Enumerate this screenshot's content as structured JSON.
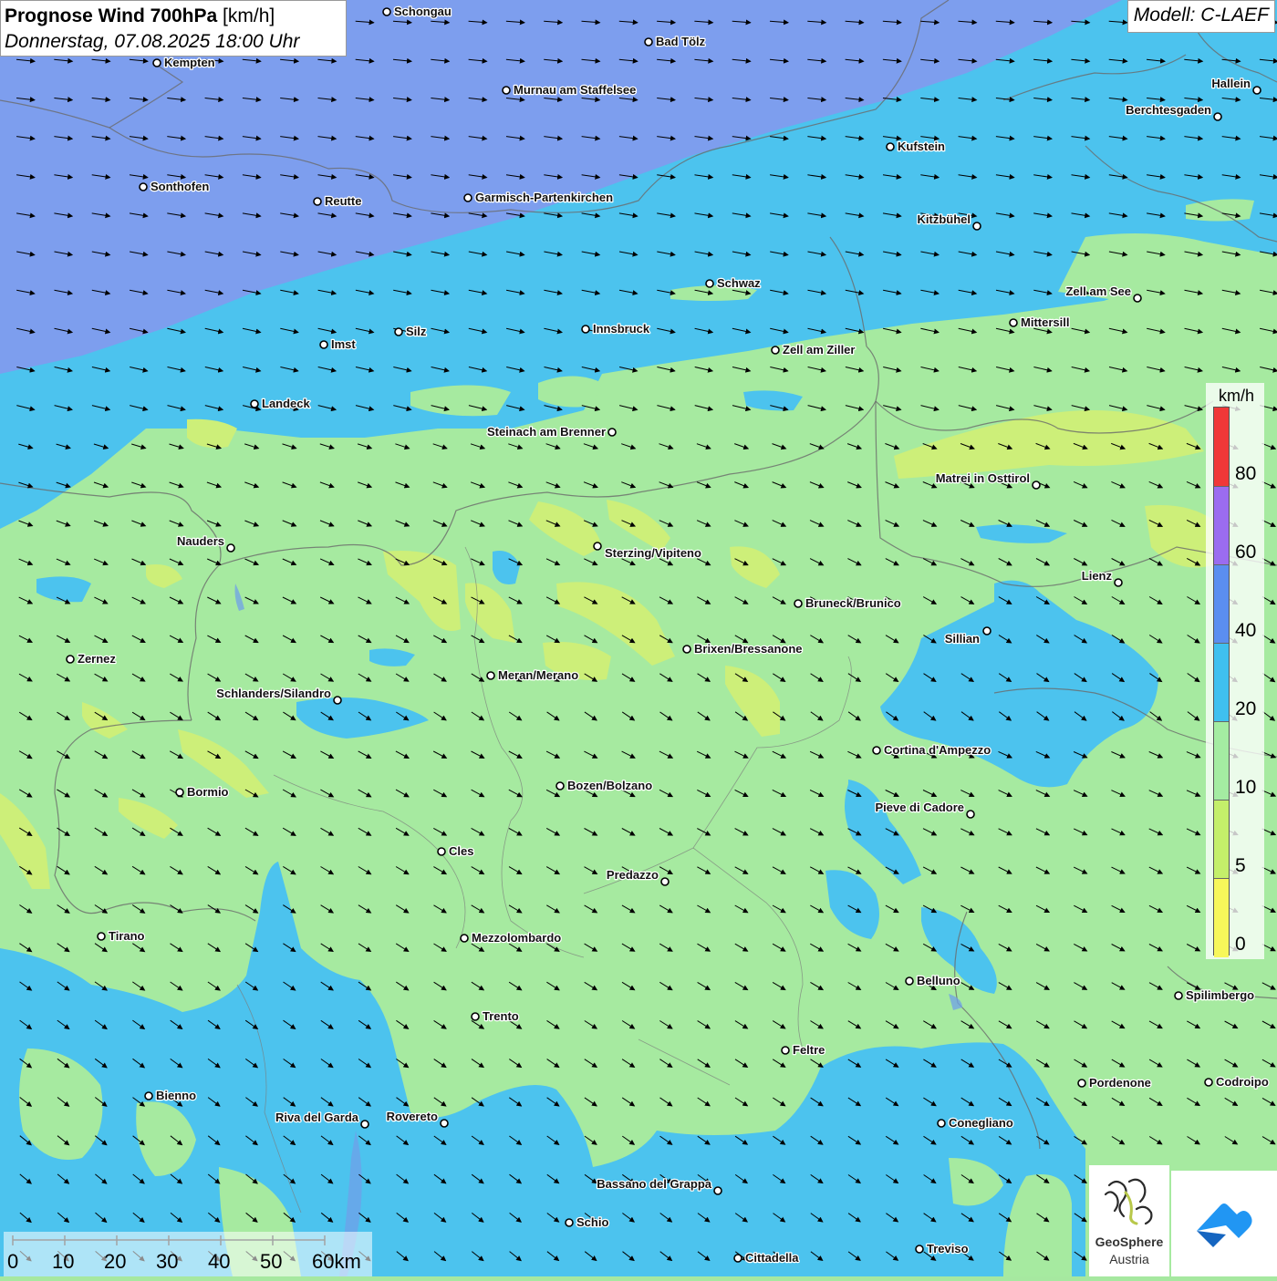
{
  "header": {
    "title_bold": "Prognose Wind 700hPa",
    "title_unit": "[km/h]",
    "subtitle": "Donnerstag, 07.08.2025 18:00 Uhr",
    "model": "Modell: C-LAEF"
  },
  "legend": {
    "unit": "km/h",
    "classes": [
      {
        "label": "0",
        "color": "#f7f75a"
      },
      {
        "label": "5",
        "color": "#c4ef6a"
      },
      {
        "label": "10",
        "color": "#a4eca2"
      },
      {
        "label": "20",
        "color": "#3fc0ef"
      },
      {
        "label": "40",
        "color": "#5b8ef0"
      },
      {
        "label": "60",
        "color": "#9b6cf0"
      },
      {
        "label": "80",
        "color": "#f03838"
      }
    ]
  },
  "scalebar": {
    "ticks": [
      "0",
      "10",
      "20",
      "30",
      "40",
      "50",
      "60km"
    ]
  },
  "logos": {
    "geosphere_line1": "GeoSphere",
    "geosphere_line2": "Austria"
  },
  "cities": [
    {
      "name": "Schongau"
    },
    {
      "name": "Bad Tölz"
    },
    {
      "name": "Kempten"
    },
    {
      "name": "Murnau am Staffelsee"
    },
    {
      "name": "Hallein"
    },
    {
      "name": "Berchtesgaden"
    },
    {
      "name": "Kufstein"
    },
    {
      "name": "Sonthofen"
    },
    {
      "name": "Reutte"
    },
    {
      "name": "Garmisch-Partenkirchen"
    },
    {
      "name": "Kitzbühel"
    },
    {
      "name": "Schwaz"
    },
    {
      "name": "Zell am See"
    },
    {
      "name": "Mittersill"
    },
    {
      "name": "Innsbruck"
    },
    {
      "name": "Silz"
    },
    {
      "name": "Imst"
    },
    {
      "name": "Zell am Ziller"
    },
    {
      "name": "Landeck"
    },
    {
      "name": "Steinach am Brenner"
    },
    {
      "name": "Matrei in Osttirol"
    },
    {
      "name": "Nauders"
    },
    {
      "name": "Sterzing/Vipiteno"
    },
    {
      "name": "Lienz"
    },
    {
      "name": "Bruneck/Brunico"
    },
    {
      "name": "Sillian"
    },
    {
      "name": "Zernez"
    },
    {
      "name": "Brixen/Bressanone"
    },
    {
      "name": "Meran/Merano"
    },
    {
      "name": "Schlanders/Silandro"
    },
    {
      "name": "Cortina d'Ampezzo"
    },
    {
      "name": "Bormio"
    },
    {
      "name": "Bozen/Bolzano"
    },
    {
      "name": "Pieve di Cadore"
    },
    {
      "name": "Cles"
    },
    {
      "name": "Predazzo"
    },
    {
      "name": "Tirano"
    },
    {
      "name": "Mezzolombardo"
    },
    {
      "name": "Belluno"
    },
    {
      "name": "Spilimbergo"
    },
    {
      "name": "Trento"
    },
    {
      "name": "Feltre"
    },
    {
      "name": "Pordenone"
    },
    {
      "name": "Codroipo"
    },
    {
      "name": "Bienno"
    },
    {
      "name": "Riva del Garda"
    },
    {
      "name": "Rovereto"
    },
    {
      "name": "Conegliano"
    },
    {
      "name": "Bassano del Grappa"
    },
    {
      "name": "Schio"
    },
    {
      "name": "Treviso"
    },
    {
      "name": "Cittadella"
    }
  ]
}
